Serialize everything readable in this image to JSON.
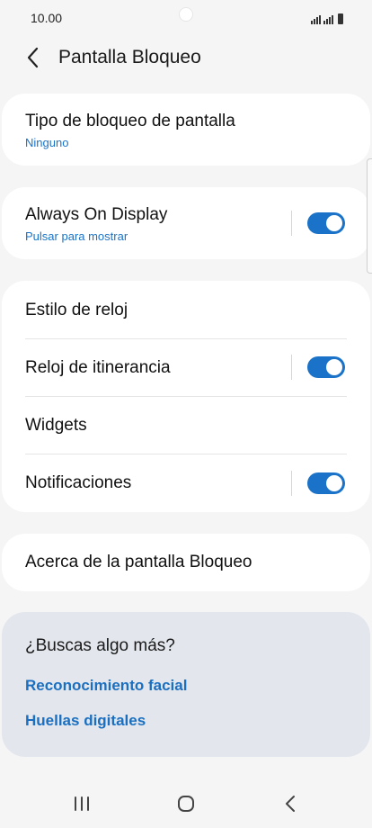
{
  "status": {
    "time": "10.00"
  },
  "header": {
    "title": "Pantalla Bloqueo"
  },
  "lock_type": {
    "title": "Tipo de bloqueo de pantalla",
    "value": "Ninguno"
  },
  "aod": {
    "title": "Always On Display",
    "subtitle": "Pulsar para mostrar",
    "enabled": true
  },
  "settings": {
    "clock_style": "Estilo de reloj",
    "roaming_clock": {
      "label": "Reloj de itinerancia",
      "enabled": true
    },
    "widgets": "Widgets",
    "notifications": {
      "label": "Notificaciones",
      "enabled": true
    }
  },
  "about": {
    "label": "Acerca de la pantalla Bloqueo"
  },
  "suggestions": {
    "title": "¿Buscas algo más?",
    "links": [
      "Reconocimiento facial",
      "Huellas digitales"
    ]
  },
  "colors": {
    "accent": "#1a73c8",
    "link": "#1a6fc0",
    "background": "#f5f5f5"
  },
  "icons": {
    "back": "chevron-left-icon",
    "signal": "signal-icon",
    "battery": "battery-icon",
    "recents": "recents-icon",
    "home": "home-icon",
    "nav_back": "nav-back-icon"
  }
}
